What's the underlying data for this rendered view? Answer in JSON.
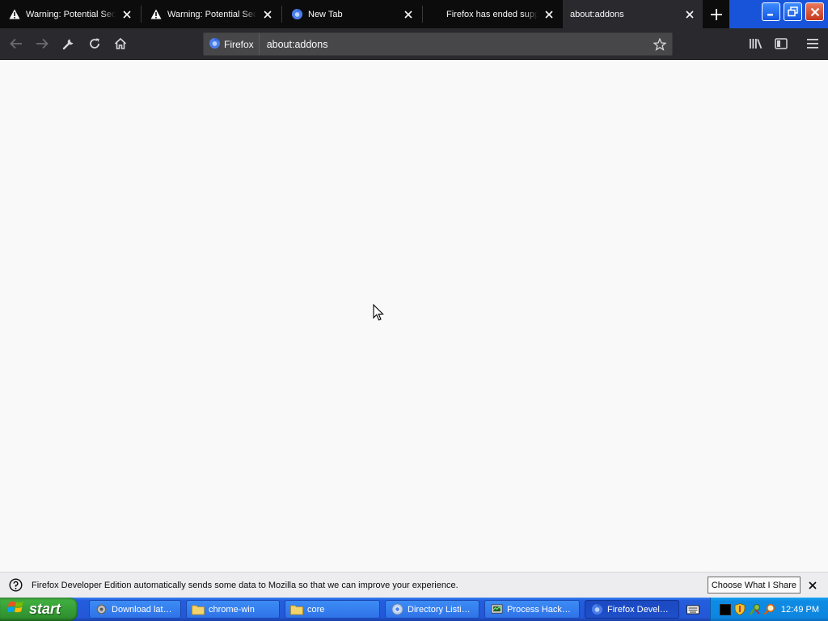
{
  "browser": {
    "tabs": [
      {
        "title": "Warning: Potential Security Risk Ahead",
        "icon": "warning-icon",
        "selected": false
      },
      {
        "title": "Warning: Potential Security Risk Ahead",
        "icon": "warning-icon",
        "selected": false
      },
      {
        "title": "New Tab",
        "icon": "firefox-icon",
        "selected": false
      },
      {
        "title": "Firefox has ended support",
        "icon": "none",
        "selected": false
      },
      {
        "title": "about:addons",
        "icon": "none",
        "selected": true
      }
    ],
    "identity_label": "Firefox",
    "url": "about:addons"
  },
  "notification": {
    "text": "Firefox Developer Edition automatically sends some data to Mozilla so that we can improve your experience.",
    "button_label": "Choose What I Share"
  },
  "taskbar": {
    "start_label": "start",
    "tasks": [
      {
        "label": "Download lat…",
        "icon": "gear-icon",
        "active": false
      },
      {
        "label": "chrome-win",
        "icon": "folder-icon",
        "active": false
      },
      {
        "label": "core",
        "icon": "folder-icon",
        "active": false
      },
      {
        "label": "Directory Listi…",
        "icon": "chrome-icon",
        "active": false
      },
      {
        "label": "Process Hack…",
        "icon": "process-icon",
        "active": false
      },
      {
        "label": "Firefox Devel…",
        "icon": "firefox-icon",
        "active": true
      }
    ],
    "clock": "12:49 PM"
  },
  "colors": {
    "tabstrip": "#0c0c0d",
    "toolbar": "#2a2a2e",
    "content": "#f9f9fa",
    "xp_blue": "#245edc",
    "start_green": "#3fae3f"
  }
}
